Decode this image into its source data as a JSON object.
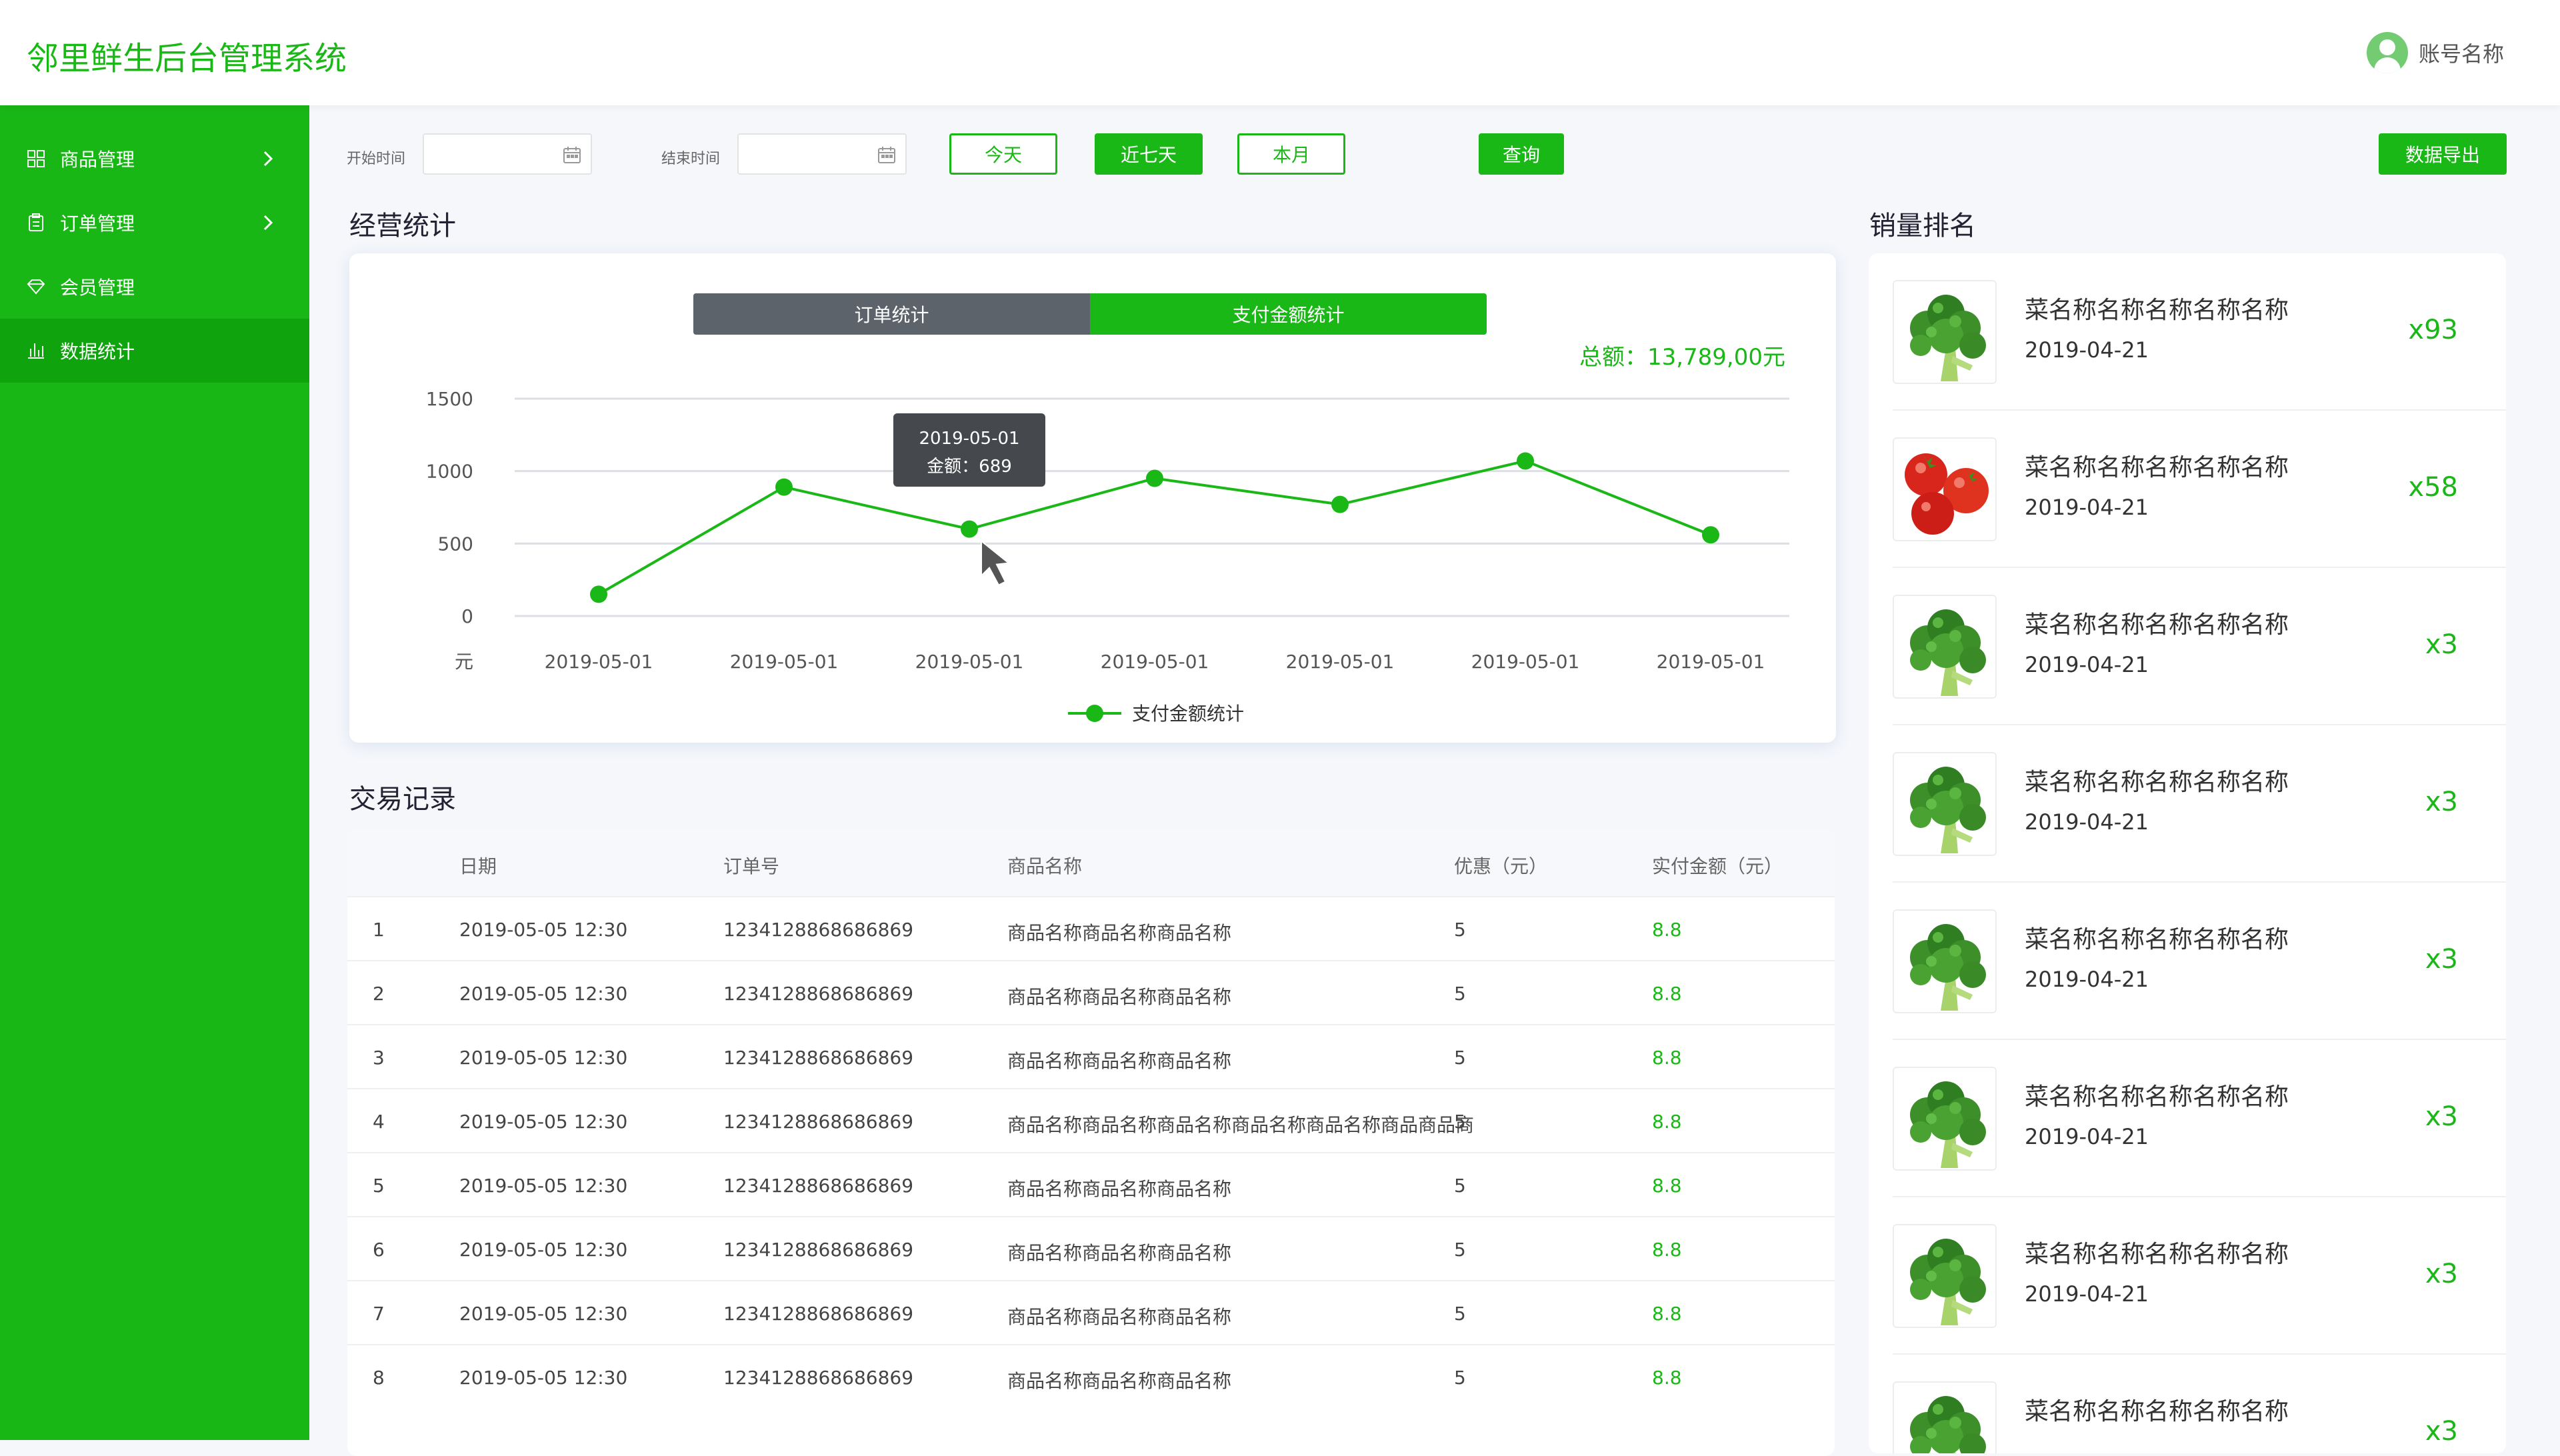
{
  "app": {
    "title": "邻里鲜生后台管理系统",
    "account": "账号名称"
  },
  "sidebar": {
    "items": [
      {
        "label": "商品管理",
        "icon": "grid-icon",
        "expandable": true,
        "active": false
      },
      {
        "label": "订单管理",
        "icon": "clipboard-icon",
        "expandable": true,
        "active": false
      },
      {
        "label": "会员管理",
        "icon": "diamond-icon",
        "expandable": false,
        "active": false
      },
      {
        "label": "数据统计",
        "icon": "bar-chart-icon",
        "expandable": false,
        "active": true
      }
    ]
  },
  "filter": {
    "start_label": "开始时间",
    "start_value": "",
    "end_label": "结束时间",
    "end_value": "",
    "btn_today": "今天",
    "btn_week": "近七天",
    "btn_month": "本月",
    "btn_query": "查询",
    "btn_export": "数据导出"
  },
  "sections": {
    "stats": "经营统计",
    "records": "交易记录",
    "ranking": "销量排名"
  },
  "chart": {
    "tabs": [
      "订单统计",
      "支付金额统计"
    ],
    "active_tab": 1,
    "total": "总额：13,789,00元",
    "tooltip_date": "2019-05-01",
    "tooltip_value": "金额：689",
    "legend": "支付金额统计",
    "y_unit": "元"
  },
  "chart_data": {
    "type": "line",
    "title": "",
    "x": [
      "2019-05-01",
      "2019-05-01",
      "2019-05-01",
      "2019-05-01",
      "2019-05-01",
      "2019-05-01",
      "2019-05-01"
    ],
    "series": [
      {
        "name": "支付金额统计",
        "values": [
          150,
          890,
          600,
          950,
          770,
          1070,
          560
        ]
      }
    ],
    "y_ticks": [
      0,
      500,
      1000,
      1500
    ],
    "ylim": [
      0,
      1500
    ],
    "ylabel": "元",
    "grid": true,
    "legend_position": "bottom-center",
    "color": "#1ab816"
  },
  "table": {
    "headers": [
      "日期",
      "订单号",
      "商品名称",
      "优惠（元）",
      "实付金额（元）"
    ],
    "rows": [
      {
        "idx": "1",
        "date": "2019-05-05 12:30",
        "order": "1234128868686869",
        "name": "商品名称商品名称商品名称",
        "discount": "5",
        "paid": "8.8"
      },
      {
        "idx": "2",
        "date": "2019-05-05 12:30",
        "order": "1234128868686869",
        "name": "商品名称商品名称商品名称",
        "discount": "5",
        "paid": "8.8"
      },
      {
        "idx": "3",
        "date": "2019-05-05 12:30",
        "order": "1234128868686869",
        "name": "商品名称商品名称商品名称",
        "discount": "5",
        "paid": "8.8"
      },
      {
        "idx": "4",
        "date": "2019-05-05 12:30",
        "order": "1234128868686869",
        "name": "商品名称商品名称商品名称商品名称商品名称商品商品商",
        "discount": "5",
        "paid": "8.8"
      },
      {
        "idx": "5",
        "date": "2019-05-05 12:30",
        "order": "1234128868686869",
        "name": "商品名称商品名称商品名称",
        "discount": "5",
        "paid": "8.8"
      },
      {
        "idx": "6",
        "date": "2019-05-05 12:30",
        "order": "1234128868686869",
        "name": "商品名称商品名称商品名称",
        "discount": "5",
        "paid": "8.8"
      },
      {
        "idx": "7",
        "date": "2019-05-05 12:30",
        "order": "1234128868686869",
        "name": "商品名称商品名称商品名称",
        "discount": "5",
        "paid": "8.8"
      },
      {
        "idx": "8",
        "date": "2019-05-05 12:30",
        "order": "1234128868686869",
        "name": "商品名称商品名称商品名称",
        "discount": "5",
        "paid": "8.8"
      }
    ]
  },
  "ranking": [
    {
      "name": "菜名称名称名称名称名称",
      "date": "2019-04-21",
      "qty": "x93",
      "image": "broccoli"
    },
    {
      "name": "菜名称名称名称名称名称",
      "date": "2019-04-21",
      "qty": "x58",
      "image": "tomato"
    },
    {
      "name": "菜名称名称名称名称名称",
      "date": "2019-04-21",
      "qty": "x3",
      "image": "broccoli"
    },
    {
      "name": "菜名称名称名称名称名称",
      "date": "2019-04-21",
      "qty": "x3",
      "image": "broccoli"
    },
    {
      "name": "菜名称名称名称名称名称",
      "date": "2019-04-21",
      "qty": "x3",
      "image": "broccoli"
    },
    {
      "name": "菜名称名称名称名称名称",
      "date": "2019-04-21",
      "qty": "x3",
      "image": "broccoli"
    },
    {
      "name": "菜名称名称名称名称名称",
      "date": "2019-04-21",
      "qty": "x3",
      "image": "broccoli"
    },
    {
      "name": "菜名称名称名称名称名称",
      "date": "",
      "qty": "x3",
      "image": "broccoli"
    }
  ],
  "colors": {
    "primary": "#1ab816",
    "sidebar_active": "#0fa40d",
    "tab_inactive": "#5d636b"
  }
}
